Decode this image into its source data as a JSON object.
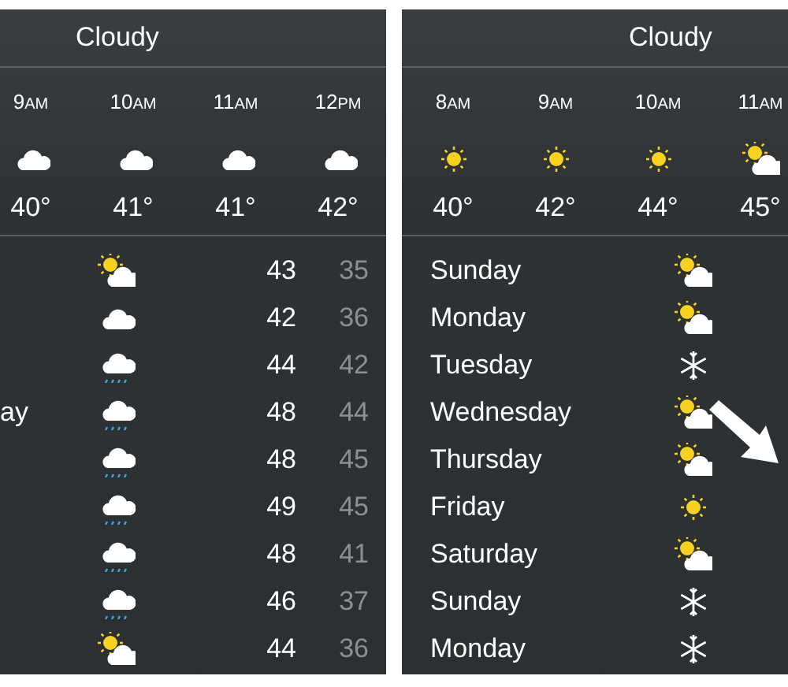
{
  "panels": [
    {
      "condition": "Cloudy",
      "hours": [
        {
          "hour": "9",
          "period": "AM",
          "kind": "cloud",
          "temp": "40°"
        },
        {
          "hour": "10",
          "period": "AM",
          "kind": "cloud",
          "temp": "41°"
        },
        {
          "hour": "11",
          "period": "AM",
          "kind": "cloud",
          "temp": "41°"
        },
        {
          "hour": "12",
          "period": "PM",
          "kind": "cloud",
          "temp": "42°"
        }
      ],
      "days": [
        {
          "kind": "partly-cloudy",
          "high": "43",
          "low": "35"
        },
        {
          "kind": "cloud",
          "high": "42",
          "low": "36"
        },
        {
          "kind": "rain",
          "high": "44",
          "low": "42"
        },
        {
          "name": "ay",
          "kind": "rain",
          "high": "48",
          "low": "44"
        },
        {
          "kind": "rain",
          "high": "48",
          "low": "45"
        },
        {
          "kind": "rain",
          "high": "49",
          "low": "45"
        },
        {
          "kind": "rain",
          "high": "48",
          "low": "41"
        },
        {
          "kind": "rain",
          "high": "46",
          "low": "37"
        },
        {
          "kind": "partly-cloudy",
          "high": "44",
          "low": "36"
        }
      ]
    },
    {
      "condition": "Cloudy",
      "hours": [
        {
          "hour": "8",
          "period": "AM",
          "kind": "sun",
          "temp": "40°"
        },
        {
          "hour": "9",
          "period": "AM",
          "kind": "sun",
          "temp": "42°"
        },
        {
          "hour": "10",
          "period": "AM",
          "kind": "sun",
          "temp": "44°"
        },
        {
          "hour": "11",
          "period": "AM",
          "kind": "partly-cloudy",
          "temp": "45°"
        }
      ],
      "days": [
        {
          "name": "Sunday",
          "kind": "partly-cloudy"
        },
        {
          "name": "Monday",
          "kind": "partly-cloudy"
        },
        {
          "name": "Tuesday",
          "kind": "snow"
        },
        {
          "name": "Wednesday",
          "kind": "partly-cloudy"
        },
        {
          "name": "Thursday",
          "kind": "partly-cloudy"
        },
        {
          "name": "Friday",
          "kind": "sun"
        },
        {
          "name": "Saturday",
          "kind": "partly-cloudy"
        },
        {
          "name": "Sunday",
          "kind": "snow"
        },
        {
          "name": "Monday",
          "kind": "snow"
        }
      ]
    }
  ]
}
